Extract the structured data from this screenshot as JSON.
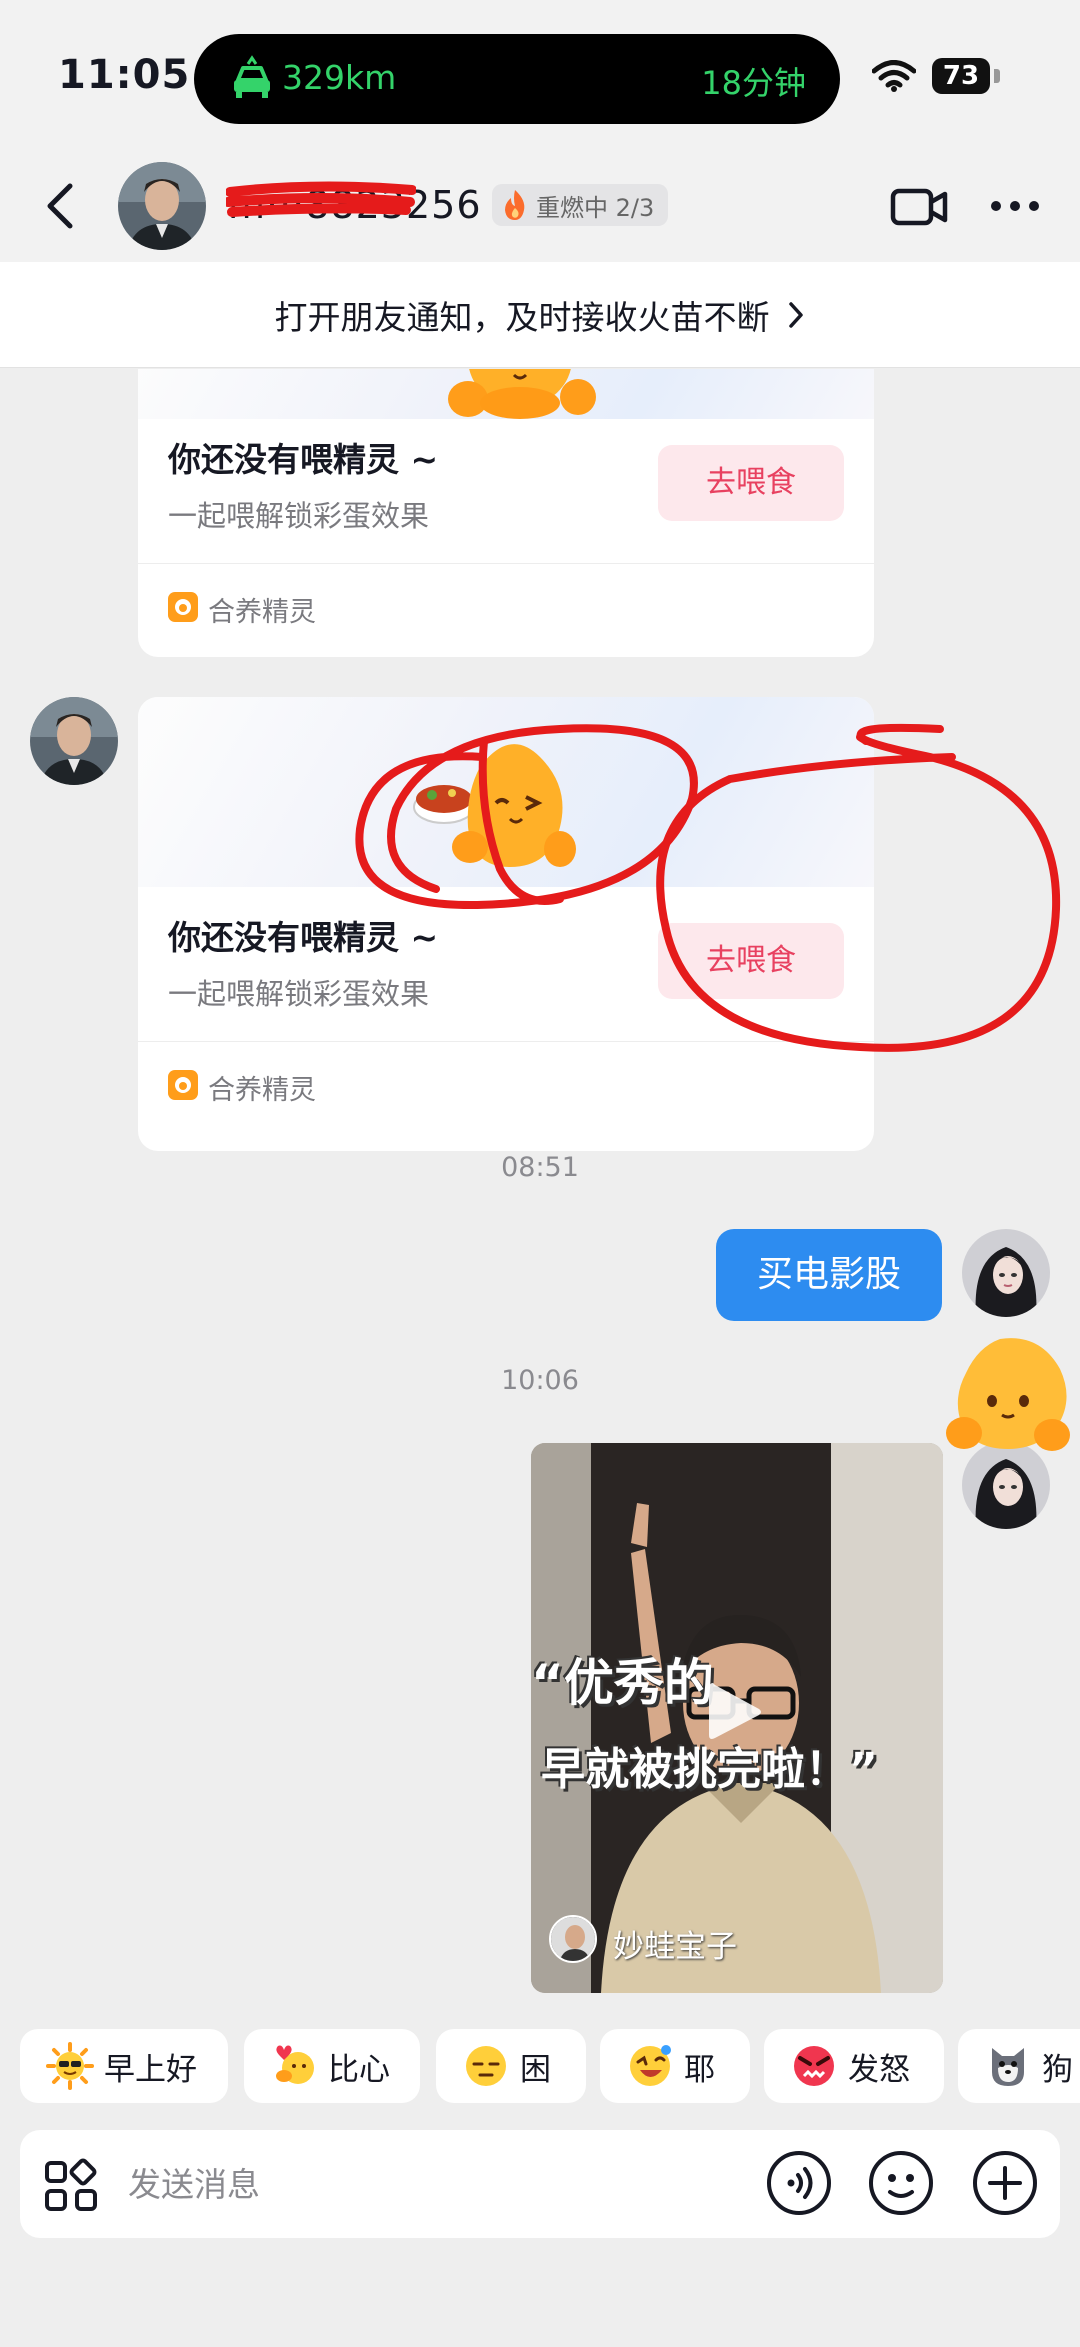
{
  "status_bar": {
    "time": "11:05",
    "navigation_distance": "329km",
    "navigation_eta": "18分钟",
    "battery_level": "73"
  },
  "header": {
    "contact_name": "m···8823256",
    "streak_label": "重燃中 2/3",
    "icons": [
      "back-icon",
      "video-call-icon",
      "more-icon",
      "flame-icon"
    ]
  },
  "notification_banner": {
    "text": "打开朋友通知，及时接收火苗不断"
  },
  "messages": {
    "cards": [
      {
        "title": "你还没有喂精灵 ~",
        "subtitle": "一起喂解锁彩蛋效果",
        "button_label": "去喂食",
        "footer": "合养精灵"
      },
      {
        "title": "你还没有喂精灵 ~",
        "subtitle": "一起喂解锁彩蛋效果",
        "button_label": "去喂食",
        "footer": "合养精灵"
      }
    ],
    "timestamp_1": "08:51",
    "sent_text": "买电影股",
    "timestamp_2": "10:06",
    "video": {
      "caption_line_1": "“优秀的",
      "caption_line_2": "早就被挑完啦！”",
      "author": "妙蛙宝子"
    }
  },
  "quick_replies": [
    {
      "label": "早上好",
      "icon": "sun-sunglasses-emoji"
    },
    {
      "label": "比心",
      "icon": "heart-hands-emoji"
    },
    {
      "label": "困",
      "icon": "sleepy-emoji"
    },
    {
      "label": "耶",
      "icon": "yay-emoji"
    },
    {
      "label": "发怒",
      "icon": "angry-emoji"
    },
    {
      "label": "狗",
      "icon": "dog-emoji"
    }
  ],
  "input_bar": {
    "placeholder": "发送消息",
    "icons": [
      "apps-icon",
      "voice-icon",
      "emoji-icon",
      "plus-icon"
    ]
  },
  "colors": {
    "accent_blue": "#2d8cf0",
    "feed_button_text": "#e84160",
    "nav_green": "#34d36a",
    "annotation_red": "#e51b1b"
  }
}
